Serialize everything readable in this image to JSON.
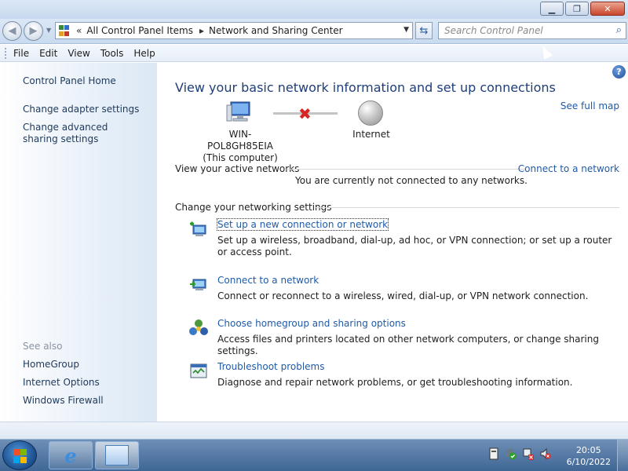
{
  "address": {
    "crumbs": [
      "All Control Panel Items",
      "Network and Sharing Center"
    ],
    "search_placeholder": "Search Control Panel"
  },
  "menu": [
    "File",
    "Edit",
    "View",
    "Tools",
    "Help"
  ],
  "sidebar": {
    "home": "Control Panel Home",
    "items": [
      "Change adapter settings",
      "Change advanced sharing settings"
    ],
    "see_also_label": "See also",
    "see_also": [
      "HomeGroup",
      "Internet Options",
      "Windows Firewall"
    ]
  },
  "main": {
    "title": "View your basic network information and set up connections",
    "see_full_map": "See full map",
    "computer_name": "WIN-POL8GH85EIA",
    "computer_sub": "(This computer)",
    "internet_label": "Internet",
    "active_networks": "View your active networks",
    "connect_to_network": "Connect to a network",
    "not_connected": "You are currently not connected to any networks.",
    "change_settings": "Change your networking settings",
    "tasks": [
      {
        "link": "Set up a new connection or network",
        "desc": "Set up a wireless, broadband, dial-up, ad hoc, or VPN connection; or set up a router or access point."
      },
      {
        "link": "Connect to a network",
        "desc": "Connect or reconnect to a wireless, wired, dial-up, or VPN network connection."
      },
      {
        "link": "Choose homegroup and sharing options",
        "desc": "Access files and printers located on other network computers, or change sharing settings."
      },
      {
        "link": "Troubleshoot problems",
        "desc": "Diagnose and repair network problems, or get troubleshooting information."
      }
    ]
  },
  "taskbar": {
    "time": "20:05",
    "date": "6/10/2022"
  },
  "colors": {
    "link": "#1f5aa8",
    "title": "#1e3e7a",
    "sidebar_text": "#1e395b",
    "error_x": "#d92323"
  }
}
